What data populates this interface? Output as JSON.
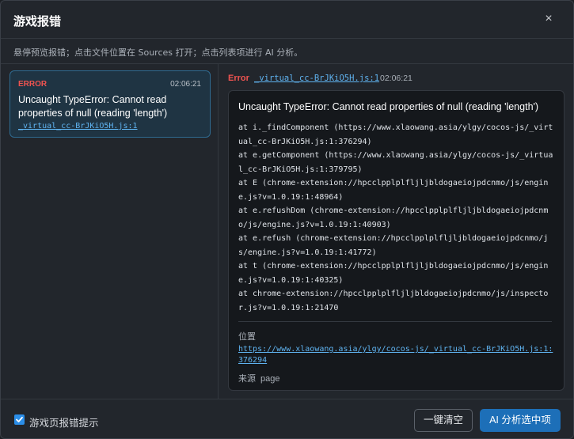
{
  "dialog": {
    "title": "游戏报错",
    "close_icon": "×",
    "subtitle": "悬停预览报错；点击文件位置在 Sources 打开；点击列表项进行 AI 分析。"
  },
  "error_list": [
    {
      "level": "ERROR",
      "time": "02:06:21",
      "message": "Uncaught TypeError: Cannot read properties of null (reading 'length')",
      "file": "_virtual_cc-BrJKiO5H.js:1"
    }
  ],
  "detail": {
    "level": "Error",
    "file": "_virtual_cc-BrJKiO5H.js:1",
    "time": "02:06:21",
    "message": "Uncaught TypeError: Cannot read properties of null (reading 'length')",
    "stack": [
      "at i._findComponent (https://www.xlaowang.asia/ylgy/cocos-js/_virtual_cc-BrJKiO5H.js:1:376294)",
      "at e.getComponent (https://www.xlaowang.asia/ylgy/cocos-js/_virtual_cc-BrJKiO5H.js:1:379795)",
      "at E (chrome-extension://hpcclpplplfljljbldogaeiojpdcnmo/js/engine.js?v=1.0.19:1:48964)",
      "at e.refushDom (chrome-extension://hpcclpplplfljljbldogaeiojpdcnmo/js/engine.js?v=1.0.19:1:40903)",
      "at e.refush (chrome-extension://hpcclpplplfljljbldogaeiojpdcnmo/js/engine.js?v=1.0.19:1:41772)",
      "at t (chrome-extension://hpcclpplplfljljbldogaeiojpdcnmo/js/engine.js?v=1.0.19:1:40325)",
      "at chrome-extension://hpcclpplplfljljbldogaeiojpdcnmo/js/inspector.js?v=1.0.19:1:21470"
    ],
    "location_label": "位置",
    "location_url": "https://www.xlaowang.asia/ylgy/cocos-js/_virtual_cc-BrJKiO5H.js:1:376294",
    "source_label": "来源",
    "source_value": "page"
  },
  "footer": {
    "checkbox_label": "游戏页报错提示",
    "checkbox_checked": true,
    "clear_label": "一键清空",
    "ai_label": "AI 分析选中项"
  },
  "colors": {
    "accent": "#2b8ee8",
    "error": "#ef5350",
    "link": "#5fb3f0"
  }
}
